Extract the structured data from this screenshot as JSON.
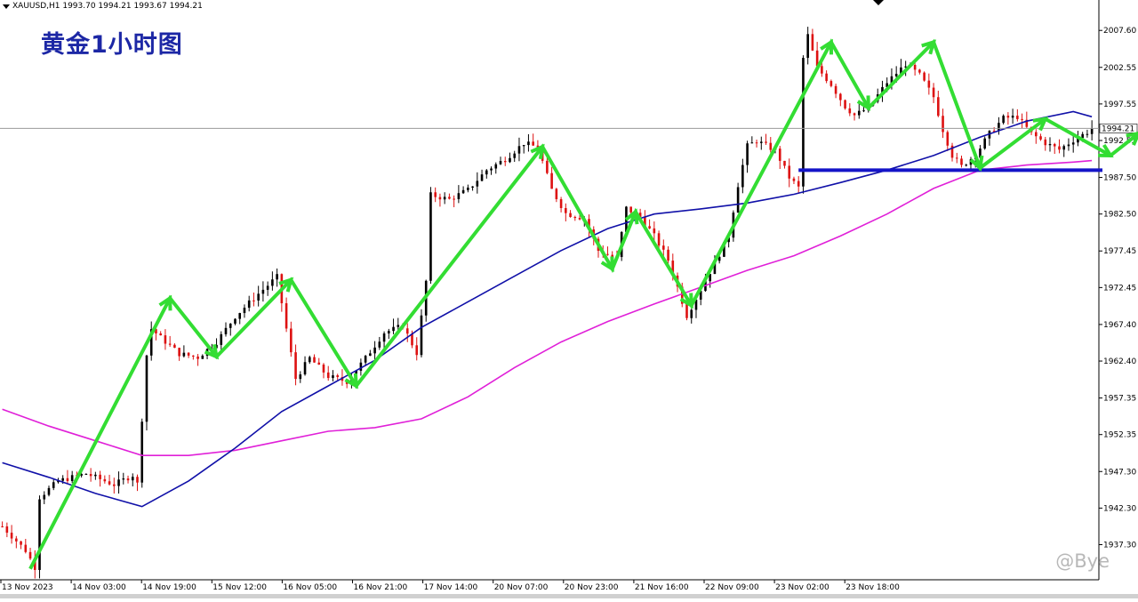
{
  "header": {
    "symbol_info": "XAUUSD,H1  1993.70 1994.21 1993.67 1994.21"
  },
  "title": "黄金1小时图",
  "watermark": "@Bye",
  "colors": {
    "bull": "#000000",
    "bear": "#dd1111",
    "ma_fast": "#1010a8",
    "ma_slow": "#e020d8",
    "zigzag": "#33dd33",
    "support": "#1414c8",
    "price_line": "#9a9a9a",
    "title": "#1c27a5"
  },
  "chart_data": {
    "type": "candlestick",
    "symbol": "XAUUSD",
    "timeframe": "H1",
    "ohlc_header": {
      "open": 1993.7,
      "high": 1994.21,
      "low": 1993.67,
      "close": 1994.21
    },
    "current_price": 1994.21,
    "ylim": [
      1932.5,
      2010.3
    ],
    "y_ticks": [
      2007.6,
      2002.55,
      1997.55,
      1992.55,
      1987.5,
      1982.5,
      1977.45,
      1972.45,
      1967.4,
      1962.4,
      1957.35,
      1952.35,
      1947.3,
      1942.3,
      1937.3
    ],
    "x_labels": [
      "13 Nov 2023",
      "14 Nov 03:00",
      "14 Nov 19:00",
      "15 Nov 12:00",
      "16 Nov 05:00",
      "16 Nov 21:00",
      "17 Nov 14:00",
      "20 Nov 07:00",
      "20 Nov 23:00",
      "21 Nov 16:00",
      "22 Nov 09:00",
      "23 Nov 02:00",
      "23 Nov 18:00"
    ],
    "price_path": [
      [
        0,
        1939.8
      ],
      [
        5,
        1936.5
      ],
      [
        7,
        1934.2
      ],
      [
        8,
        1943.8
      ],
      [
        12,
        1946.0
      ],
      [
        18,
        1947.0
      ],
      [
        24,
        1945.5
      ],
      [
        28,
        1946.8
      ],
      [
        29,
        1945.6
      ],
      [
        30,
        1954.5
      ],
      [
        31,
        1963.2
      ],
      [
        32,
        1966.8
      ],
      [
        34,
        1965.6
      ],
      [
        38,
        1963.4
      ],
      [
        42,
        1962.9
      ],
      [
        46,
        1965.0
      ],
      [
        50,
        1968.5
      ],
      [
        55,
        1971.6
      ],
      [
        59,
        1973.9
      ],
      [
        61,
        1966.8
      ],
      [
        63,
        1960.0
      ],
      [
        66,
        1962.8
      ],
      [
        70,
        1960.3
      ],
      [
        74,
        1959.6
      ],
      [
        78,
        1962.8
      ],
      [
        82,
        1966.3
      ],
      [
        86,
        1967.2
      ],
      [
        89,
        1963.5
      ],
      [
        91,
        1973.3
      ],
      [
        92,
        1985.1
      ],
      [
        96,
        1984.5
      ],
      [
        100,
        1985.8
      ],
      [
        104,
        1988.5
      ],
      [
        108,
        1990.0
      ],
      [
        112,
        1992.2
      ],
      [
        115,
        1991.6
      ],
      [
        118,
        1985.8
      ],
      [
        121,
        1982.6
      ],
      [
        125,
        1981.9
      ],
      [
        128,
        1977.5
      ],
      [
        132,
        1976.4
      ],
      [
        134,
        1983.3
      ],
      [
        137,
        1982.1
      ],
      [
        140,
        1979.5
      ],
      [
        143,
        1976.2
      ],
      [
        145,
        1972.5
      ],
      [
        147,
        1968.6
      ],
      [
        150,
        1972.2
      ],
      [
        153,
        1975.8
      ],
      [
        156,
        1979.5
      ],
      [
        158,
        1986.5
      ],
      [
        160,
        1991.8
      ],
      [
        162,
        1992.5
      ],
      [
        166,
        1991.2
      ],
      [
        169,
        1987.5
      ],
      [
        171,
        1986.1
      ],
      [
        172,
        2003.8
      ],
      [
        173,
        2006.9
      ],
      [
        175,
        2002.5
      ],
      [
        178,
        2000.2
      ],
      [
        181,
        1997.2
      ],
      [
        183,
        1996.0
      ],
      [
        186,
        1997.0
      ],
      [
        190,
        2000.5
      ],
      [
        194,
        2003.0
      ],
      [
        197,
        2001.5
      ],
      [
        200,
        1998.5
      ],
      [
        202,
        1994.0
      ],
      [
        204,
        1990.5
      ],
      [
        206,
        1989.0
      ],
      [
        209,
        1990.6
      ],
      [
        212,
        1993.5
      ],
      [
        215,
        1995.6
      ],
      [
        218,
        1995.8
      ],
      [
        221,
        1993.5
      ],
      [
        224,
        1992.2
      ],
      [
        227,
        1991.3
      ],
      [
        230,
        1992.6
      ],
      [
        233,
        1993.7
      ],
      [
        234,
        1994.21
      ]
    ],
    "ma_fast": [
      [
        0,
        1948.5
      ],
      [
        10,
        1946.5
      ],
      [
        20,
        1944.3
      ],
      [
        30,
        1942.5
      ],
      [
        40,
        1946.0
      ],
      [
        50,
        1950.5
      ],
      [
        60,
        1955.5
      ],
      [
        70,
        1959.0
      ],
      [
        80,
        1962.5
      ],
      [
        90,
        1967.0
      ],
      [
        100,
        1970.5
      ],
      [
        110,
        1974.0
      ],
      [
        120,
        1977.5
      ],
      [
        130,
        1980.5
      ],
      [
        140,
        1982.5
      ],
      [
        150,
        1983.2
      ],
      [
        160,
        1984.0
      ],
      [
        170,
        1985.2
      ],
      [
        180,
        1986.8
      ],
      [
        190,
        1988.5
      ],
      [
        200,
        1990.5
      ],
      [
        210,
        1993.0
      ],
      [
        220,
        1995.2
      ],
      [
        230,
        1996.5
      ],
      [
        234,
        1995.8
      ]
    ],
    "ma_slow": [
      [
        0,
        1955.8
      ],
      [
        10,
        1953.5
      ],
      [
        20,
        1951.5
      ],
      [
        30,
        1949.5
      ],
      [
        40,
        1949.5
      ],
      [
        50,
        1950.2
      ],
      [
        60,
        1951.5
      ],
      [
        70,
        1952.8
      ],
      [
        80,
        1953.3
      ],
      [
        90,
        1954.5
      ],
      [
        100,
        1957.5
      ],
      [
        110,
        1961.5
      ],
      [
        120,
        1965.0
      ],
      [
        130,
        1967.8
      ],
      [
        140,
        1970.2
      ],
      [
        150,
        1972.5
      ],
      [
        160,
        1974.8
      ],
      [
        170,
        1976.8
      ],
      [
        180,
        1979.5
      ],
      [
        190,
        1982.5
      ],
      [
        200,
        1986.0
      ],
      [
        210,
        1988.5
      ],
      [
        220,
        1989.2
      ],
      [
        230,
        1989.6
      ],
      [
        234,
        1989.8
      ]
    ],
    "zigzag": [
      [
        6,
        1934.0
      ],
      [
        36,
        1971.0
      ],
      [
        46,
        1963.0
      ],
      [
        62,
        1973.5
      ],
      [
        76,
        1959.0
      ],
      [
        116,
        1991.7
      ],
      [
        131,
        1975.0
      ],
      [
        136,
        1982.8
      ],
      [
        148,
        1970.0
      ],
      [
        178,
        2006.0
      ],
      [
        186,
        1997.0
      ],
      [
        200,
        2006.0
      ],
      [
        210,
        1988.8
      ],
      [
        224,
        1995.5
      ],
      [
        238,
        1990.5
      ],
      [
        244,
        1993.5
      ],
      [
        255,
        2002.0
      ]
    ],
    "support_level": 1988.5
  },
  "arrow_width": 3
}
